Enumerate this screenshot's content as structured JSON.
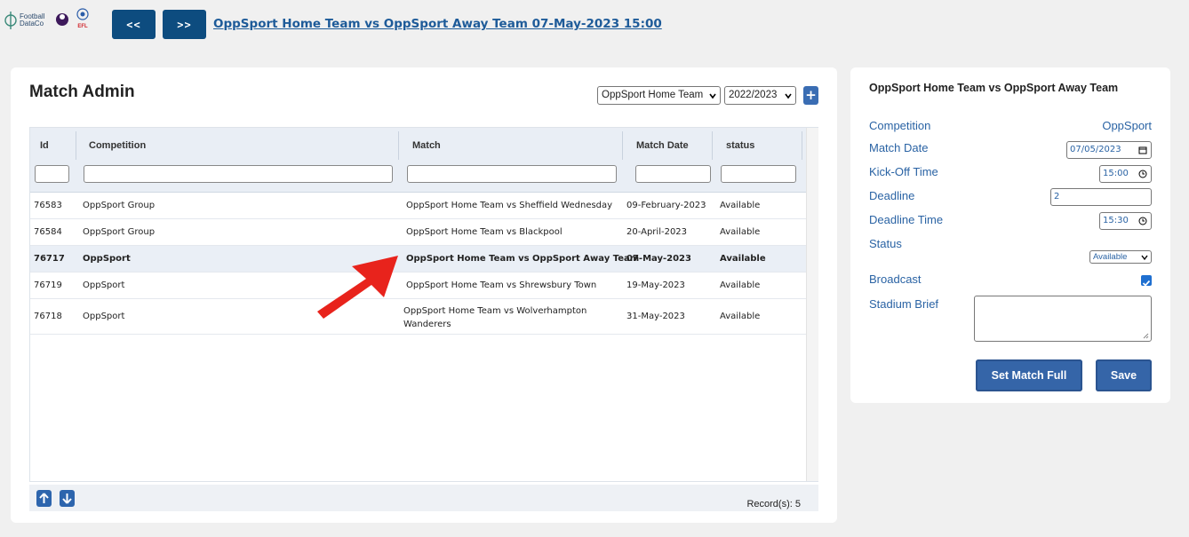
{
  "header": {
    "logo_text_line1": "Football",
    "logo_text_line2": "DataCo",
    "logo_badge_text": "EFL",
    "prev_label": "<<",
    "next_label": ">>",
    "match_link": "OppSport Home Team vs OppSport Away Team 07-May-2023 15:00"
  },
  "admin": {
    "title": "Match Admin",
    "team_select": "OppSport Home Team",
    "season_select": "2022/2023",
    "add_label": "+"
  },
  "table": {
    "columns": [
      "Id",
      "Competition",
      "Match",
      "Match Date",
      "status"
    ],
    "rows": [
      {
        "id": "76583",
        "competition": "OppSport Group",
        "match": "OppSport Home Team vs Sheffield Wednesday",
        "date": "09-February-2023",
        "status": "Available"
      },
      {
        "id": "76584",
        "competition": "OppSport Group",
        "match": "OppSport Home Team vs Blackpool",
        "date": "20-April-2023",
        "status": "Available"
      },
      {
        "id": "76717",
        "competition": "OppSport",
        "match": "OppSport Home Team vs OppSport Away Team",
        "date": "07-May-2023",
        "status": "Available"
      },
      {
        "id": "76719",
        "competition": "OppSport",
        "match": "OppSport Home Team vs Shrewsbury Town",
        "date": "19-May-2023",
        "status": "Available"
      },
      {
        "id": "76718",
        "competition": "OppSport",
        "match": "OppSport Home Team vs Wolverhampton Wanderers",
        "date": "31-May-2023",
        "status": "Available"
      }
    ],
    "records": "Record(s): 5"
  },
  "detail": {
    "title": "OppSport Home Team vs OppSport Away Team",
    "competition_label": "Competition",
    "competition_value": "OppSport",
    "match_date_label": "Match Date",
    "match_date_value": "07/05/2023",
    "kickoff_label": "Kick-Off Time",
    "kickoff_value": "15:00",
    "deadline_label": "Deadline",
    "deadline_value": "2",
    "deadline_time_label": "Deadline Time",
    "deadline_time_value": "15:30",
    "status_label": "Status",
    "status_value": "Available",
    "broadcast_label": "Broadcast",
    "broadcast_checked": true,
    "stadium_brief_label": "Stadium Brief",
    "stadium_brief_value": "",
    "set_full_label": "Set Match Full",
    "save_label": "Save"
  },
  "colors": {
    "nav_button": "#0d4c7f",
    "link": "#1e5b99",
    "label_blue": "#2a63a4",
    "action_button": "#3565a8",
    "annotation_arrow": "#e8231c"
  }
}
